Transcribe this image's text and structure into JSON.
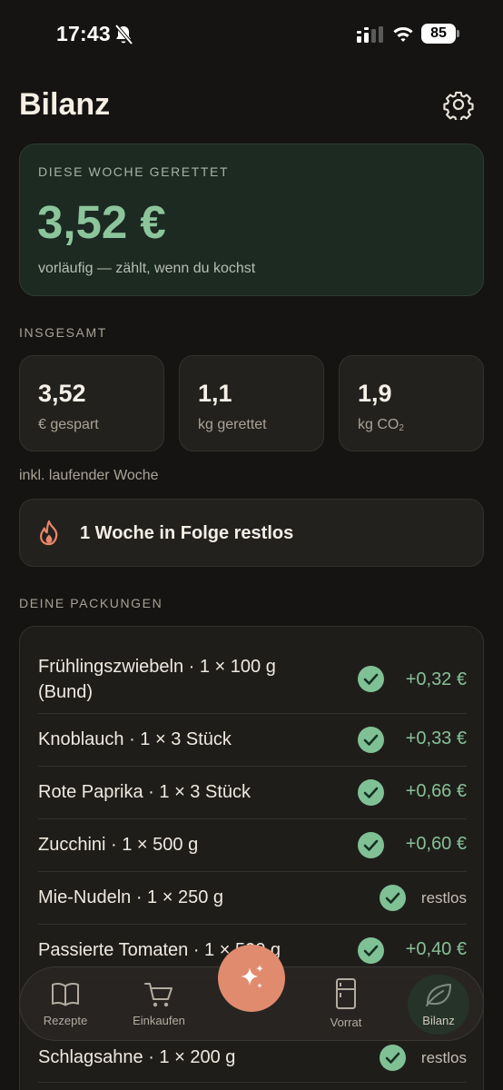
{
  "status_bar": {
    "time": "17:43",
    "battery": "85"
  },
  "header": {
    "title": "Bilanz"
  },
  "hero": {
    "label": "DIESE WOCHE GERETTET",
    "value": "3,52 €",
    "note": "vorläufig — zählt, wenn du kochst"
  },
  "totals": {
    "label": "INSGESAMT",
    "cards": [
      {
        "value": "3,52",
        "unit": "€ gespart"
      },
      {
        "value": "1,1",
        "unit": "kg gerettet"
      },
      {
        "value": "1,9",
        "unit": "kg CO",
        "unit_sub": "2"
      }
    ],
    "footnote": "inkl. laufender Woche"
  },
  "streak": {
    "text": "1 Woche in Folge restlos"
  },
  "packages": {
    "label": "DEINE PACKUNGEN",
    "items": [
      {
        "name": "Frühlingszwiebeln · 1 × 100 g (Bund)",
        "value": "+0,32 €",
        "status": "saved"
      },
      {
        "name": "Knoblauch · 1 × 3 Stück",
        "value": "+0,33 €",
        "status": "saved"
      },
      {
        "name": "Rote Paprika · 1 × 3 Stück",
        "value": "+0,66 €",
        "status": "saved"
      },
      {
        "name": "Zucchini · 1 × 500 g",
        "value": "+0,60 €",
        "status": "saved"
      },
      {
        "name": "Mie-Nudeln · 1 × 250 g",
        "value": "restlos",
        "status": "restlos"
      },
      {
        "name": "Passierte Tomaten · 1 × 500 g",
        "value": "+0,40 €",
        "status": "saved"
      },
      {
        "name": "Schlagsahne · 1 × 200 g",
        "value": "restlos",
        "status": "restlos"
      }
    ]
  },
  "nav": {
    "items": [
      {
        "label": "Rezepte",
        "icon": "book-icon"
      },
      {
        "label": "Einkaufen",
        "icon": "cart-icon"
      },
      {
        "label": "",
        "icon": "sparkles-icon"
      },
      {
        "label": "Vorrat",
        "icon": "fridge-icon"
      },
      {
        "label": "Bilanz",
        "icon": "leaf-icon",
        "active": true
      }
    ]
  },
  "colors": {
    "background": "#151412",
    "accent_green": "#86c196",
    "check_green": "#7fc195",
    "fab_orange": "#e08b6e",
    "flame_orange": "#e8876a"
  }
}
